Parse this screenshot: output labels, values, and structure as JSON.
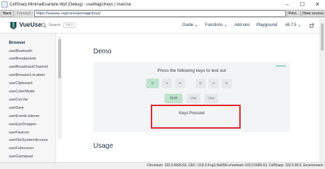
{
  "window": {
    "title": "CefSharp.MinimalExample.Wpf (Debug) - useMagicKeys | VueUse",
    "controls": {
      "minimize": "–",
      "maximize": "☐",
      "close": "✕"
    }
  },
  "browser_nav": {
    "back": "Back",
    "forward": "Forward",
    "url": "https://vueuse.org/core/usemagickeys/",
    "print": "Print...",
    "view_source": "View source"
  },
  "site_header": {
    "logo": "VueUse",
    "search_placeholder": "Search",
    "search_shortcut": "Ctrl K",
    "nav": {
      "guide": "Guide",
      "functions": "Functions",
      "addons": "Add-ons",
      "playground": "Playground",
      "version": "v8.7.5"
    },
    "accent": "#42b883",
    "icons": {
      "search": "search-icon",
      "external": "external-link-icon",
      "github": "github-icon"
    }
  },
  "sidebar": {
    "heading": "Browser",
    "items": [
      "useBluetooth",
      "useBreakpoints",
      "useBroadcastChannel",
      "useBrowserLocation",
      "useClipboard",
      "useColorMode",
      "useCssVar",
      "useDark",
      "useEventListener",
      "useEyeDropper",
      "useFavicon",
      "useFileSystemAccess",
      "useFullscreen",
      "useGamepad"
    ]
  },
  "main": {
    "demo_title": "Demo",
    "source_link": "source",
    "instructions": "Press the following keys to test out",
    "keys_row1": [
      "V",
      "u",
      "e",
      "U",
      "s",
      "e"
    ],
    "keys_row2": [
      "Shift",
      "Vue",
      "Use"
    ],
    "keys_pressed_label": "Keys Pressed",
    "usage_title": "Usage"
  },
  "status_bar": {
    "text": "Chromium: 102.0.5005.63, CEF: r102.0.9+g1c5e658+chromium-102.0.5005.63, CefSharp: 102.0.90.0, Environment: x64"
  }
}
